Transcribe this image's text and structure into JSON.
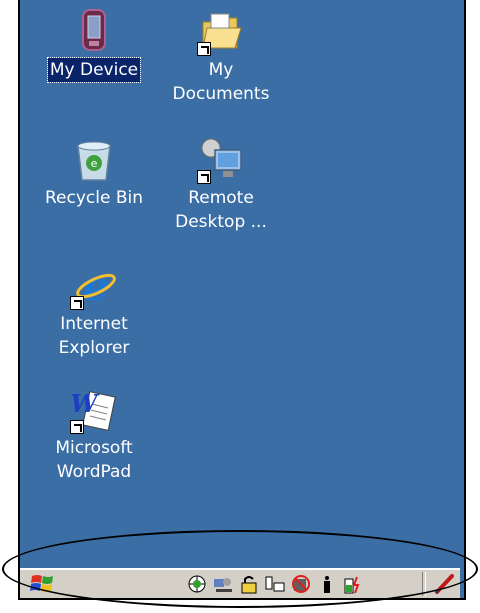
{
  "desktop": {
    "icons": [
      {
        "id": "my-device",
        "label": "My Device",
        "selected": true
      },
      {
        "id": "my-documents",
        "label": "My Documents",
        "selected": false
      },
      {
        "id": "recycle-bin",
        "label": "Recycle Bin",
        "selected": false
      },
      {
        "id": "remote-desktop",
        "label": "Remote Desktop ...",
        "selected": false
      },
      {
        "id": "internet-explorer",
        "label": "Internet Explorer",
        "selected": false
      },
      {
        "id": "microsoft-wordpad",
        "label": "Microsoft WordPad",
        "selected": false
      }
    ]
  },
  "taskbar": {
    "tray_icons": [
      "network-globe-icon",
      "connection-icon",
      "lock-icon",
      "keyboard-icon",
      "no-signal-icon",
      "battery-icon",
      "charging-icon"
    ],
    "pen_icon": "pen-icon",
    "start_icon": "windows-flag-icon"
  },
  "colors": {
    "desktop": "#3a6ea5",
    "taskbar": "#d4d0c8",
    "selection": "#0a246a"
  }
}
